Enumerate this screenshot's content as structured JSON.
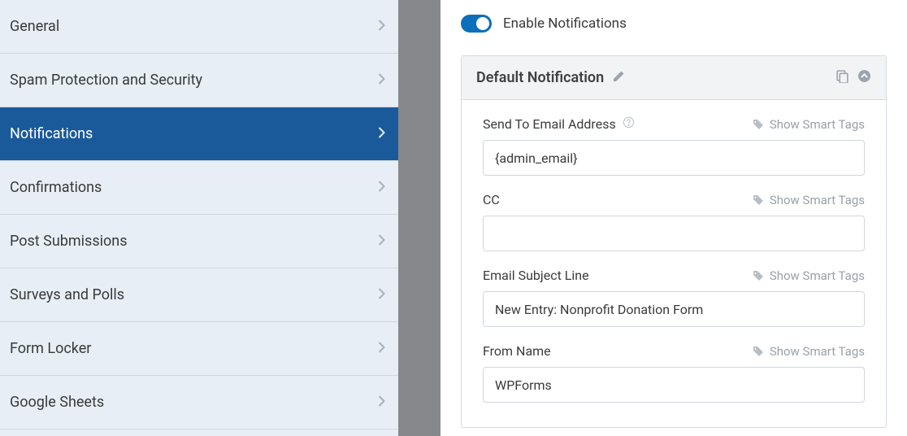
{
  "sidebar": {
    "items": [
      {
        "label": "General",
        "active": false
      },
      {
        "label": "Spam Protection and Security",
        "active": false
      },
      {
        "label": "Notifications",
        "active": true
      },
      {
        "label": "Confirmations",
        "active": false
      },
      {
        "label": "Post Submissions",
        "active": false
      },
      {
        "label": "Surveys and Polls",
        "active": false
      },
      {
        "label": "Form Locker",
        "active": false
      },
      {
        "label": "Google Sheets",
        "active": false
      }
    ]
  },
  "main": {
    "enable_toggle_label": "Enable Notifications",
    "enable_toggle_state": true,
    "panel": {
      "title": "Default Notification",
      "smart_tags_label": "Show Smart Tags",
      "fields": {
        "send_to": {
          "label": "Send To Email Address",
          "value": "{admin_email}"
        },
        "cc": {
          "label": "CC",
          "value": ""
        },
        "subject": {
          "label": "Email Subject Line",
          "value": "New Entry: Nonprofit Donation Form"
        },
        "from_name": {
          "label": "From Name",
          "value": "WPForms"
        }
      }
    }
  }
}
